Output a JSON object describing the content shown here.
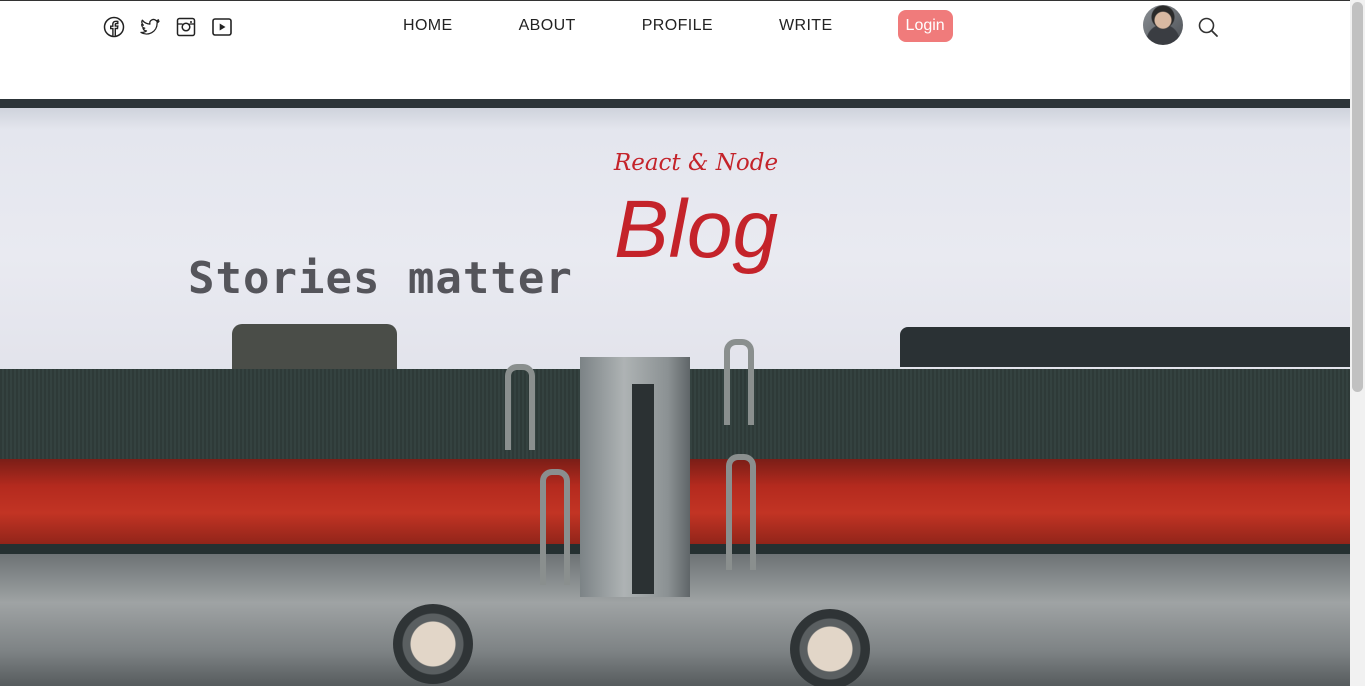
{
  "social": {
    "icons": [
      "facebook-icon",
      "twitter-icon",
      "instagram-icon",
      "youtube-icon"
    ]
  },
  "nav": {
    "items": [
      {
        "label": "HOME"
      },
      {
        "label": "ABOUT"
      },
      {
        "label": "PROFILE"
      },
      {
        "label": "WRITE"
      }
    ],
    "login_label": "Login",
    "search_icon": "search-icon",
    "avatar": "avatar"
  },
  "hero": {
    "subtitle": "React & Node",
    "title": "Blog",
    "typed_text": "Stories matter"
  },
  "colors": {
    "accent": "#c4232a",
    "login_bg": "#f07b7b"
  }
}
